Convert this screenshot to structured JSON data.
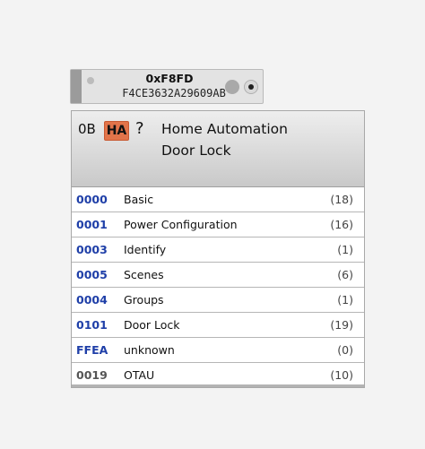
{
  "node": {
    "nwk_address": "0xF8FD",
    "mac_address": "F4CE3632A29609AB"
  },
  "endpoint": {
    "id": "0B",
    "profile_badge": "HA",
    "unknown_badge": "?",
    "title_line1": "Home Automation",
    "title_line2": "Door Lock"
  },
  "clusters": [
    {
      "id": "0000",
      "name": "Basic",
      "count": "(18)",
      "id_color": "#1f3fa8"
    },
    {
      "id": "0001",
      "name": "Power Configuration",
      "count": "(16)",
      "id_color": "#1f3fa8"
    },
    {
      "id": "0003",
      "name": "Identify",
      "count": "(1)",
      "id_color": "#1f3fa8"
    },
    {
      "id": "0005",
      "name": "Scenes",
      "count": "(6)",
      "id_color": "#1f3fa8"
    },
    {
      "id": "0004",
      "name": "Groups",
      "count": "(1)",
      "id_color": "#1f3fa8"
    },
    {
      "id": "0101",
      "name": "Door Lock",
      "count": "(19)",
      "id_color": "#1f3fa8"
    },
    {
      "id": "FFEA",
      "name": "unknown",
      "count": "(0)",
      "id_color": "#1f3fa8"
    },
    {
      "id": "0019",
      "name": "OTAU",
      "count": "(10)",
      "id_color": "#555555"
    }
  ],
  "colors": {
    "server_cluster": "#1f3fa8",
    "client_cluster": "#555555",
    "ha_badge": "#e2744a"
  }
}
